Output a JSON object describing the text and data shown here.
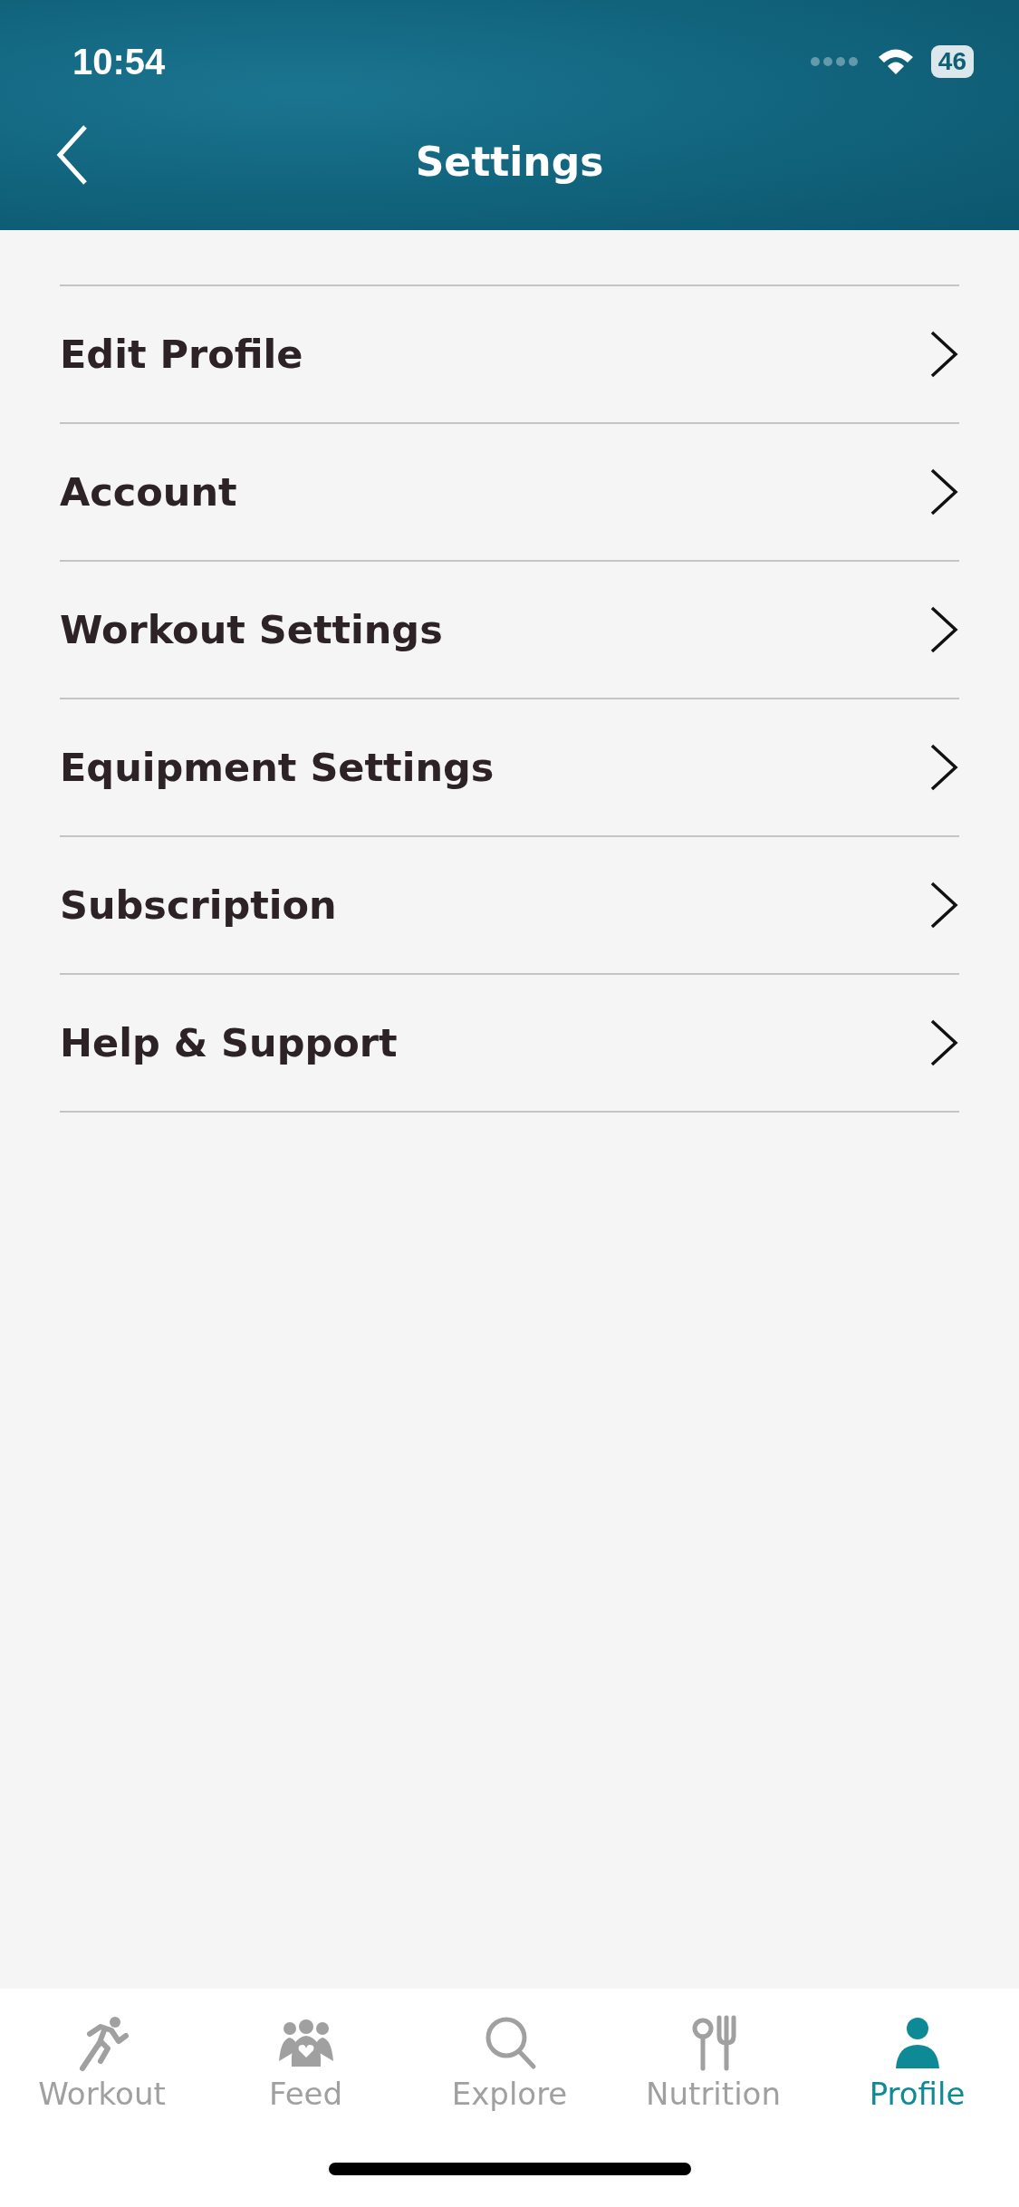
{
  "status_bar": {
    "time": "10:54",
    "battery": "46"
  },
  "header": {
    "title": "Settings"
  },
  "menu": [
    {
      "label": "Edit Profile"
    },
    {
      "label": "Account"
    },
    {
      "label": "Workout Settings"
    },
    {
      "label": "Equipment Settings"
    },
    {
      "label": "Subscription"
    },
    {
      "label": "Help & Support"
    }
  ],
  "tabs": [
    {
      "label": "Workout",
      "selected": false
    },
    {
      "label": "Feed",
      "selected": false
    },
    {
      "label": "Explore",
      "selected": false
    },
    {
      "label": "Nutrition",
      "selected": false
    },
    {
      "label": "Profile",
      "selected": true
    }
  ]
}
